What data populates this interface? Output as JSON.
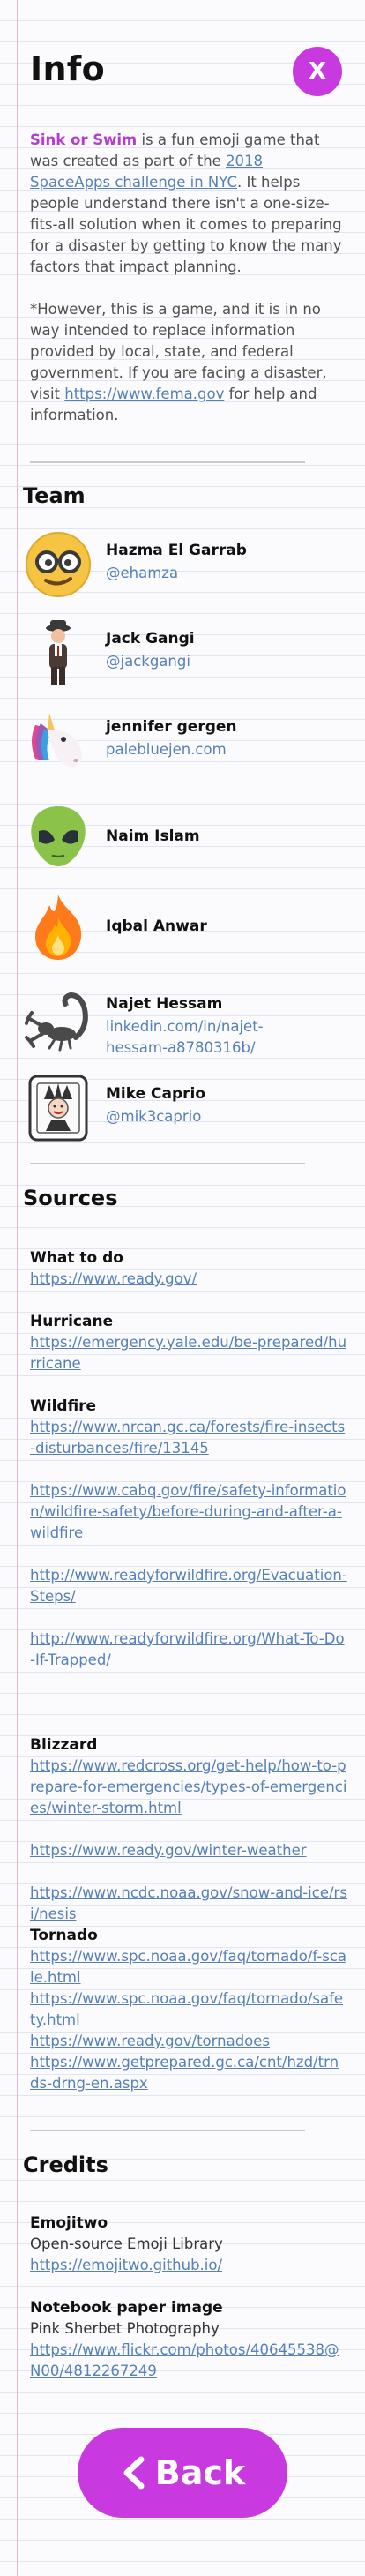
{
  "header": {
    "title": "Info",
    "close_label": "X"
  },
  "intro": {
    "brand": "Sink or Swim",
    "p1_a": " is a fun emoji game that was created as part of the ",
    "p1_link": "2018 SpaceApps challenge in NYC",
    "p1_b": ". It helps people understand there isn't a one-size-fits-all solution when it comes to preparing for a disaster by getting to know the many factors that impact planning.",
    "p2_a": "*However, this is a game, and it is in no way intended to replace  information provided by local, state, and federal government. If you are facing a disaster, visit ",
    "p2_link": "https://www.fema.gov",
    "p2_b": " for help and information."
  },
  "team": {
    "title": "Team",
    "members": [
      {
        "name": "Hazma El Garrab",
        "handle": "@ehamza",
        "icon": "nerd-face-icon"
      },
      {
        "name": "Jack Gangi",
        "handle": "@jackgangi",
        "icon": "detective-icon"
      },
      {
        "name": "jennifer gergen",
        "handle": "palebluejen.com",
        "icon": "unicorn-icon"
      },
      {
        "name": "Naim Islam",
        "handle": "",
        "icon": "alien-icon"
      },
      {
        "name": "Iqbal Anwar",
        "handle": "",
        "icon": "fire-icon"
      },
      {
        "name": "Najet Hessam",
        "handle": "linkedin.com/in/najet-hessam-a8780316b/",
        "icon": "scorpion-icon"
      },
      {
        "name": "Mike Caprio",
        "handle": "@mik3caprio",
        "icon": "joker-card-icon"
      }
    ]
  },
  "sources": {
    "title": "Sources",
    "groups": [
      {
        "heading": "What to do",
        "links": [
          "https://www.ready.gov/"
        ]
      },
      {
        "heading": "Hurricane",
        "links": [
          "https://emergency.yale.edu/be-prepared/hurricane"
        ]
      },
      {
        "heading": "Wildfire",
        "links": [
          "https://www.nrcan.gc.ca/forests/fire-insects-disturbances/fire/13145",
          "https://www.cabq.gov/fire/safety-information/wildfire-safety/before-during-and-after-a-wildfire",
          "http://www.readyforwildfire.org/Evacuation-Steps/",
          "http://www.readyforwildfire.org/What-To-Do-If-Trapped/"
        ]
      },
      {
        "heading": "Blizzard",
        "links": [
          "https://www.redcross.org/get-help/how-to-prepare-for-emergencies/types-of-emergencies/winter-storm.html",
          "https://www.ready.gov/winter-weather",
          "https://www.ncdc.noaa.gov/snow-and-ice/rsi/nesis"
        ]
      },
      {
        "heading": "Tornado",
        "links": [
          "https://www.spc.noaa.gov/faq/tornado/f-scale.html",
          "https://www.spc.noaa.gov/faq/tornado/safety.html",
          "https://www.ready.gov/tornadoes",
          "https://www.getprepared.gc.ca/cnt/hzd/trnds-drng-en.aspx"
        ]
      }
    ]
  },
  "credits": {
    "title": "Credits",
    "emojitwo_title": "Emojitwo",
    "emojitwo_desc": "Open-source Emoji Library",
    "emojitwo_link": "https://emojitwo.github.io/",
    "paper_title": "Notebook paper image",
    "paper_author": "Pink Sherbet Photography",
    "paper_link": "https://www.flickr.com/photos/40645538@N00/4812267249"
  },
  "footer": {
    "back_label": "Back"
  },
  "colors": {
    "accent": "#c83ae0",
    "brand_text": "#b43bd0",
    "link": "#5580b8"
  }
}
